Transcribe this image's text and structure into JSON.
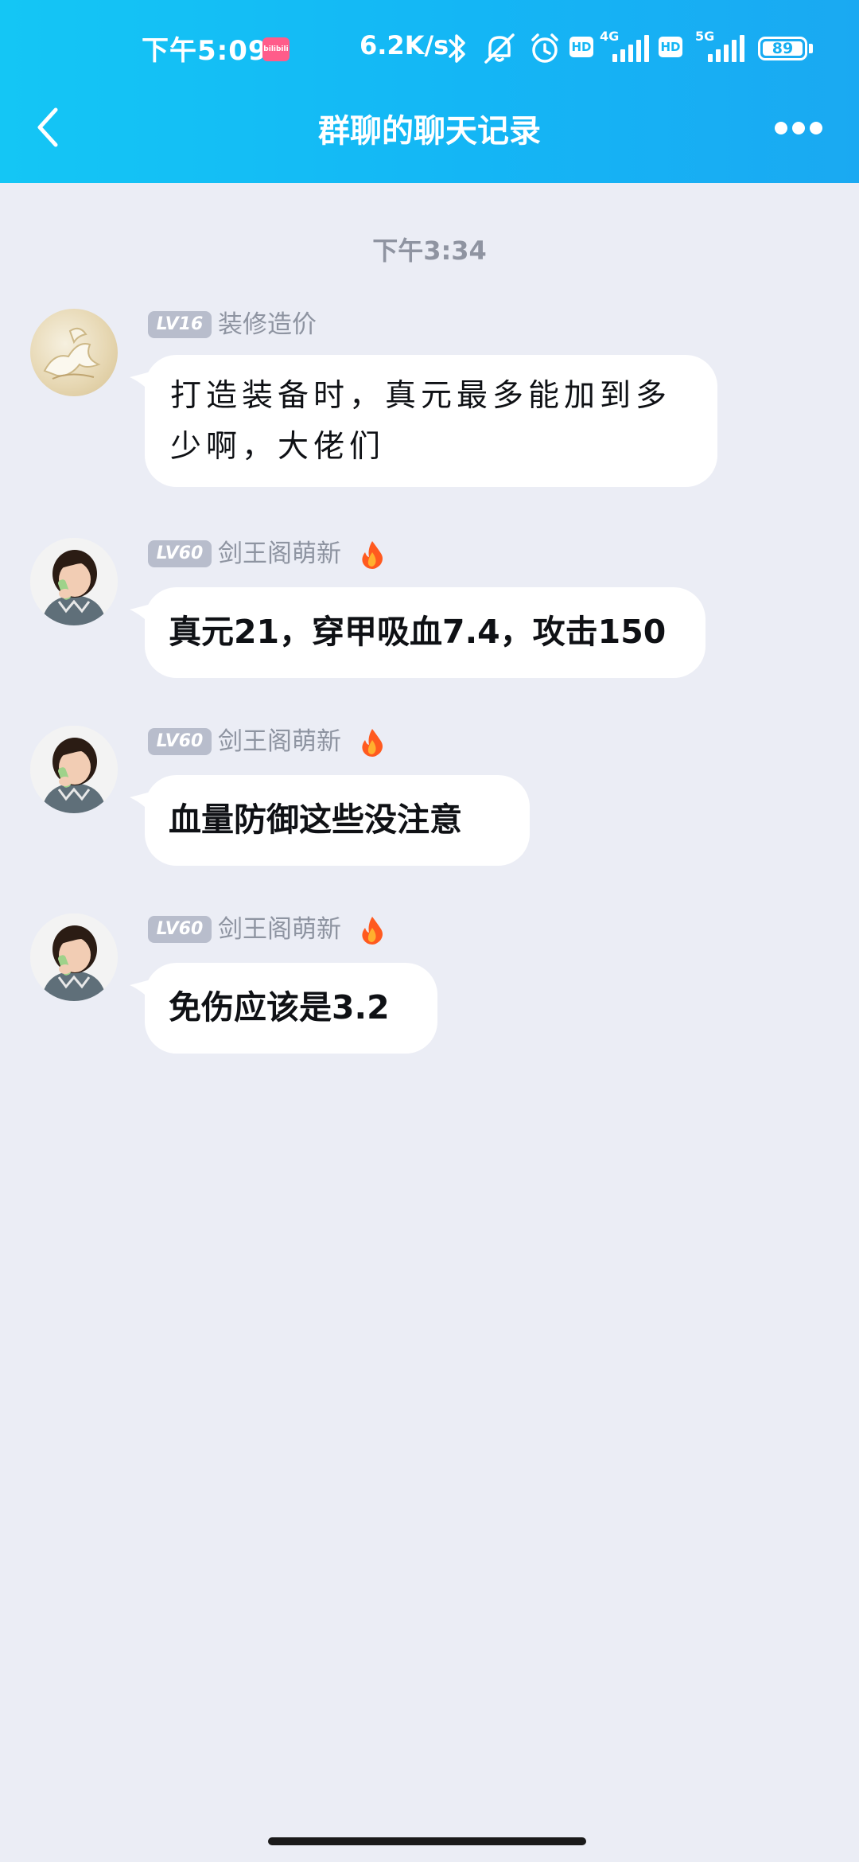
{
  "status_bar": {
    "time": "下午5:09",
    "app_badge": "bilibili",
    "net_speed": "6.2K/s",
    "network_4g": "4G",
    "network_5g": "5G",
    "hd_label": "HD",
    "battery": "89"
  },
  "header": {
    "title": "群聊的聊天记录"
  },
  "chat": {
    "timestamp": "下午3:34",
    "messages": [
      {
        "level": "LV16",
        "sender": "装修造价",
        "text": "打造装备时，真元最多能加到多少啊，大佬们"
      },
      {
        "level": "LV60",
        "sender": "剑王阁萌新",
        "text": "真元21，穿甲吸血7.4，攻击150"
      },
      {
        "level": "LV60",
        "sender": "剑王阁萌新",
        "text": "血量防御这些没注意"
      },
      {
        "level": "LV60",
        "sender": "剑王阁萌新",
        "text": "免伤应该是3.2"
      }
    ]
  },
  "colors": {
    "header_gradient_start": "#14c6f5",
    "header_gradient_end": "#1aa9f2",
    "chat_background": "#ebedf5",
    "bubble_background": "#ffffff",
    "level_badge": "#b8bdcc",
    "meta_text": "#8e94a1"
  }
}
